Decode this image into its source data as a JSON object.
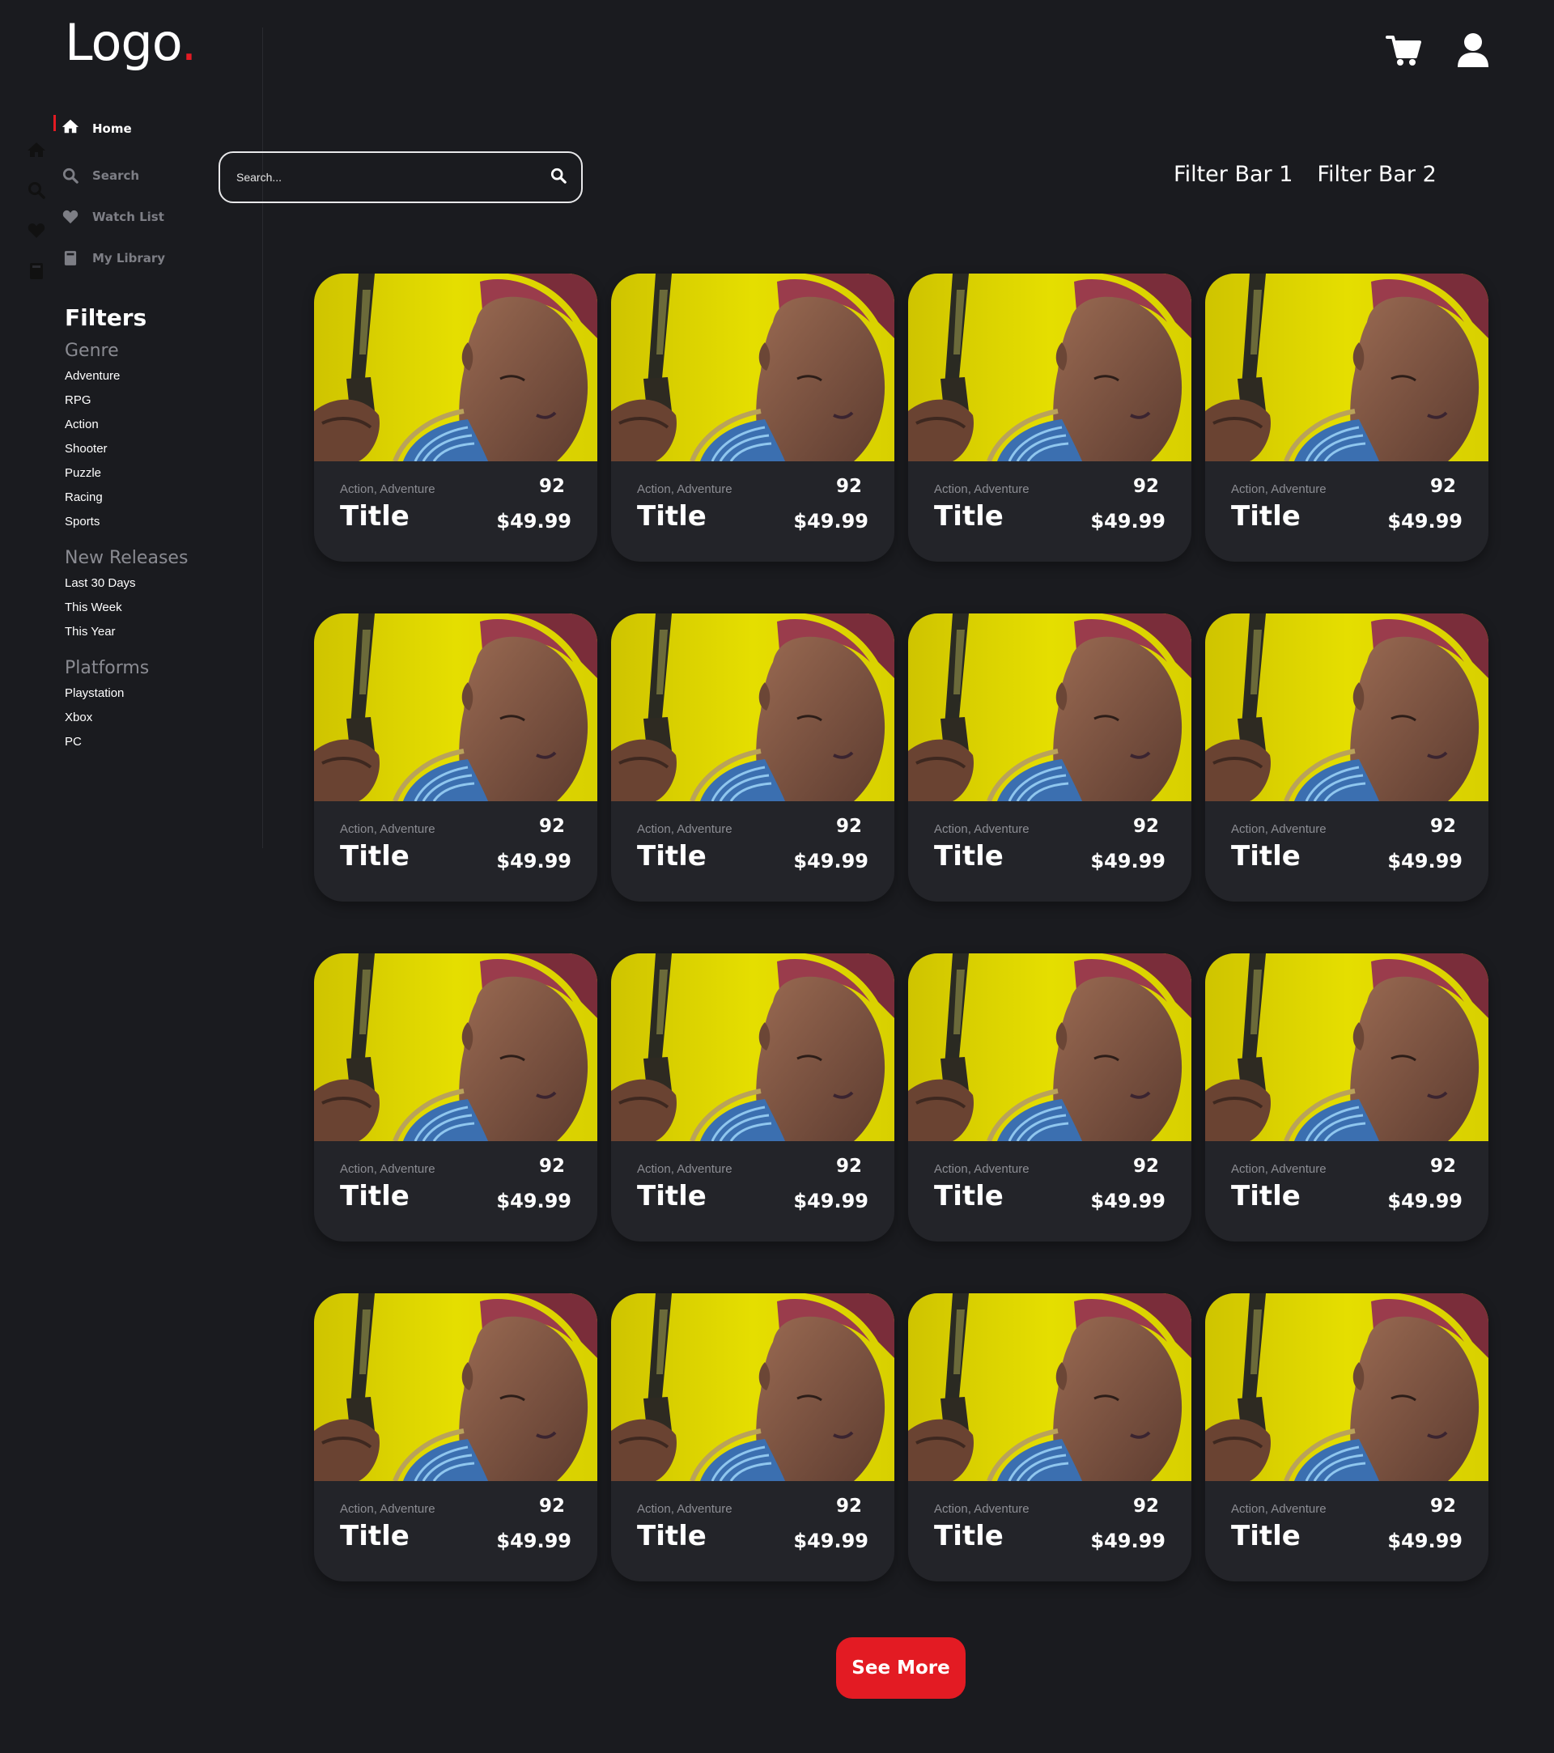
{
  "logo": {
    "text": "Logo",
    "dot": "."
  },
  "header": {
    "cart_icon": "cart-icon",
    "user_icon": "user-icon"
  },
  "nav": {
    "items": [
      {
        "label": "Home",
        "icon": "home-icon",
        "active": true
      },
      {
        "label": "Search",
        "icon": "search-icon",
        "active": false
      },
      {
        "label": "Watch List",
        "icon": "heart-icon",
        "active": false
      },
      {
        "label": "My Library",
        "icon": "book-icon",
        "active": false
      }
    ]
  },
  "filters": {
    "title": "Filters",
    "genre": {
      "heading": "Genre",
      "items": [
        "Adventure",
        "RPG",
        "Action",
        "Shooter",
        "Puzzle",
        "Racing",
        "Sports"
      ]
    },
    "new_releases": {
      "heading": "New Releases",
      "items": [
        "Last 30 Days",
        "This Week",
        "This Year"
      ]
    },
    "platforms": {
      "heading": "Platforms",
      "items": [
        "Playstation",
        "Xbox",
        "PC"
      ]
    }
  },
  "search": {
    "placeholder": "Search..."
  },
  "filter_bars": [
    "Filter Bar 1",
    "Filter Bar 2"
  ],
  "cards": [
    {
      "genre": "Action, Adventure",
      "score": "92",
      "title": "Title",
      "price": "$49.99"
    },
    {
      "genre": "Action, Adventure",
      "score": "92",
      "title": "Title",
      "price": "$49.99"
    },
    {
      "genre": "Action, Adventure",
      "score": "92",
      "title": "Title",
      "price": "$49.99"
    },
    {
      "genre": "Action, Adventure",
      "score": "92",
      "title": "Title",
      "price": "$49.99"
    },
    {
      "genre": "Action, Adventure",
      "score": "92",
      "title": "Title",
      "price": "$49.99"
    },
    {
      "genre": "Action, Adventure",
      "score": "92",
      "title": "Title",
      "price": "$49.99"
    },
    {
      "genre": "Action, Adventure",
      "score": "92",
      "title": "Title",
      "price": "$49.99"
    },
    {
      "genre": "Action, Adventure",
      "score": "92",
      "title": "Title",
      "price": "$49.99"
    },
    {
      "genre": "Action, Adventure",
      "score": "92",
      "title": "Title",
      "price": "$49.99"
    },
    {
      "genre": "Action, Adventure",
      "score": "92",
      "title": "Title",
      "price": "$49.99"
    },
    {
      "genre": "Action, Adventure",
      "score": "92",
      "title": "Title",
      "price": "$49.99"
    },
    {
      "genre": "Action, Adventure",
      "score": "92",
      "title": "Title",
      "price": "$49.99"
    },
    {
      "genre": "Action, Adventure",
      "score": "92",
      "title": "Title",
      "price": "$49.99"
    },
    {
      "genre": "Action, Adventure",
      "score": "92",
      "title": "Title",
      "price": "$49.99"
    },
    {
      "genre": "Action, Adventure",
      "score": "92",
      "title": "Title",
      "price": "$49.99"
    },
    {
      "genre": "Action, Adventure",
      "score": "92",
      "title": "Title",
      "price": "$49.99"
    }
  ],
  "see_more": "See More",
  "colors": {
    "background": "#1a1b1f",
    "card": "#232429",
    "accent": "#e31b23",
    "muted": "#8c8d93"
  }
}
